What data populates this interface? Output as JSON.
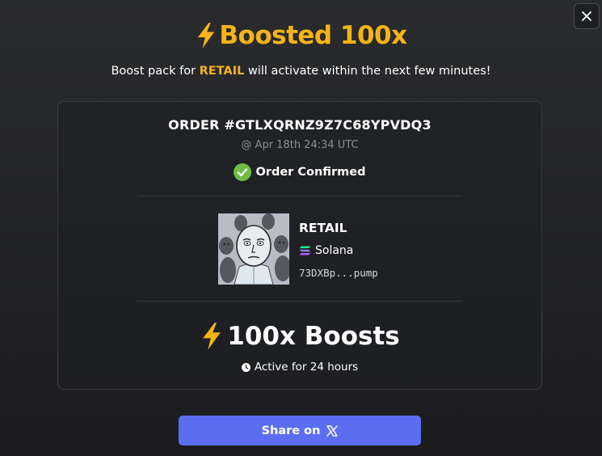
{
  "header": {
    "title": "Boosted 100x",
    "subtitle_prefix": "Boost pack for ",
    "subtitle_token": "RETAIL",
    "subtitle_suffix": " will activate within the next few minutes!"
  },
  "order": {
    "id": "ORDER #GTLXQRNZ9Z7C68YPVDQ3",
    "time": "@ Apr 18th 24:34 UTC",
    "status": "Order Confirmed"
  },
  "token": {
    "name": "RETAIL",
    "chain": "Solana",
    "address": "73DXBp...pump"
  },
  "boost": {
    "amount": "100x Boosts",
    "duration": "Active for 24 hours"
  },
  "share": {
    "label": "Share on"
  },
  "colors": {
    "accent": "#f6b416",
    "confirm": "#6dbd43",
    "button": "#5b6ef1"
  }
}
